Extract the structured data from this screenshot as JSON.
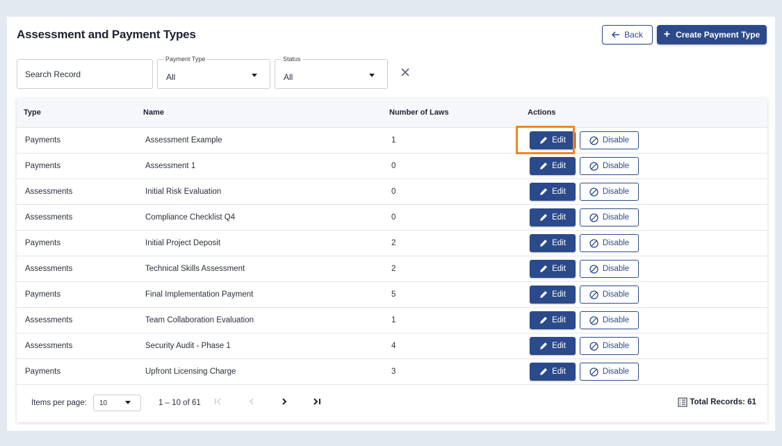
{
  "page": {
    "title": "Assessment and Payment Types",
    "back_label": "Back",
    "create_label": "Create Payment Type"
  },
  "filters": {
    "search_placeholder": "Search Record",
    "payment_type": {
      "label": "Payment Type",
      "value": "All"
    },
    "status": {
      "label": "Status",
      "value": "All"
    }
  },
  "table": {
    "headers": {
      "type": "Type",
      "name": "Name",
      "laws": "Number of Laws",
      "actions": "Actions"
    },
    "edit_label": "Edit",
    "disable_label": "Disable",
    "rows": [
      {
        "type": "Payments",
        "name": "Assessment Example",
        "laws": "1"
      },
      {
        "type": "Payments",
        "name": "Assessment 1",
        "laws": "0"
      },
      {
        "type": "Assessments",
        "name": "Initial Risk Evaluation",
        "laws": "0"
      },
      {
        "type": "Assessments",
        "name": "Compliance Checklist Q4",
        "laws": "0"
      },
      {
        "type": "Payments",
        "name": "Initial Project Deposit",
        "laws": "2"
      },
      {
        "type": "Assessments",
        "name": "Technical Skills Assessment",
        "laws": "2"
      },
      {
        "type": "Payments",
        "name": "Final Implementation Payment",
        "laws": "5"
      },
      {
        "type": "Assessments",
        "name": "Team Collaboration Evaluation",
        "laws": "1"
      },
      {
        "type": "Assessments",
        "name": "Security Audit - Phase 1",
        "laws": "4"
      },
      {
        "type": "Payments",
        "name": "Upfront Licensing Charge",
        "laws": "3"
      }
    ]
  },
  "pagination": {
    "items_per_page_label": "Items per page:",
    "items_per_page_value": "10",
    "range": "1 – 10 of 61",
    "total_label": "Total Records: 61"
  },
  "colors": {
    "primary": "#2b4a8b",
    "highlight": "#f08524",
    "background": "#e3e9f1"
  }
}
